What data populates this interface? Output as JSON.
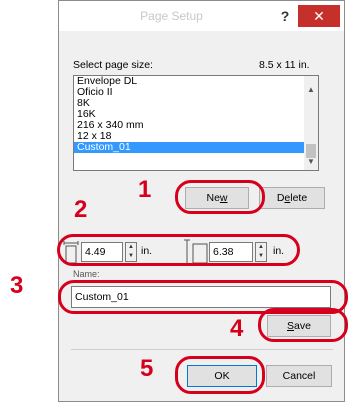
{
  "window": {
    "title": "Page Setup",
    "help_glyph": "?",
    "close_glyph": "✕"
  },
  "page_size": {
    "label": "Select page size:",
    "current_size": "8.5 x 11 in.",
    "items": [
      {
        "label": "Envelope DL",
        "selected": false
      },
      {
        "label": "Oficio II",
        "selected": false
      },
      {
        "label": "8K",
        "selected": false
      },
      {
        "label": "16K",
        "selected": false
      },
      {
        "label": "216 x 340 mm",
        "selected": false
      },
      {
        "label": "12 x 18",
        "selected": false
      },
      {
        "label": "Custom_01",
        "selected": true
      }
    ]
  },
  "buttons": {
    "new_pre": "Ne",
    "new_ul": "w",
    "delete_pre": "D",
    "delete_ul": "e",
    "delete_post": "lete",
    "save_ul": "S",
    "save_post": "ave",
    "ok": "OK",
    "cancel": "Cancel"
  },
  "dimensions": {
    "width_value": "4.49",
    "height_value": "6.38",
    "unit": "in."
  },
  "name": {
    "label": "Name:",
    "value": "Custom_01"
  },
  "callouts": {
    "c1": "1",
    "c2": "2",
    "c3": "3",
    "c4": "4",
    "c5": "5"
  },
  "colors": {
    "callout_red": "#d7001c",
    "selection_blue": "#3399ff",
    "close_red": "#c6302b"
  }
}
